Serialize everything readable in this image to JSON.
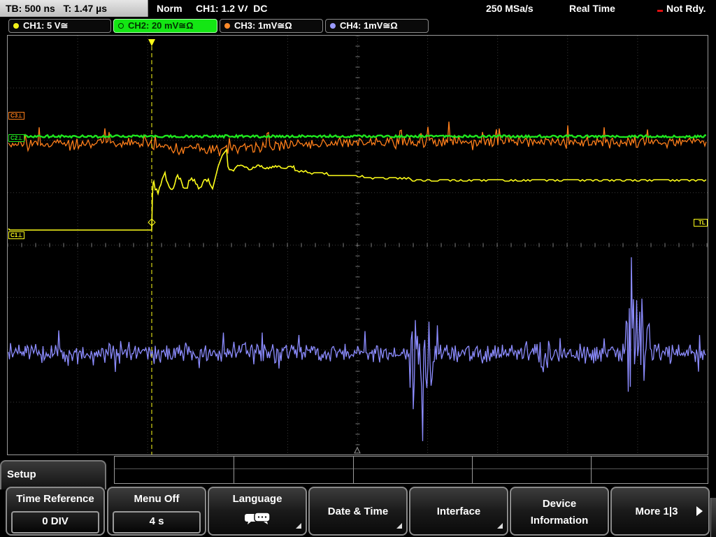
{
  "status_bar": {
    "timebase": "TB: 500 ns",
    "trigger_time": "T: 1.47 µs",
    "trigger_mode": "Norm",
    "trigger_source": "CH1: 1.2 V",
    "trigger_coupling": "DC",
    "sample_rate": "250 MSa/s",
    "acquire_mode": "Real Time",
    "status": "Not Rdy."
  },
  "channels": [
    {
      "label": "CH1: 5 V≅",
      "color": "#f2f21a",
      "active": false
    },
    {
      "label": "CH2: 20 mV≅Ω",
      "color": "#14e614",
      "active": true
    },
    {
      "label": "CH3: 1mV≅Ω",
      "color": "#ff8a2a",
      "active": false
    },
    {
      "label": "CH4: 1mV≅Ω",
      "color": "#9a9aff",
      "active": false
    }
  ],
  "markers": {
    "c3": "C3⊥",
    "c2": "C2⊥",
    "c1": "C1⊥",
    "tl": "TL",
    "t": "T"
  },
  "menu": {
    "title": "Setup",
    "softkeys": [
      {
        "label": "Time Reference",
        "value": "0 DIV",
        "icon": null
      },
      {
        "label": "Menu Off",
        "value": "4 s",
        "icon": null
      },
      {
        "label": "Language",
        "value": null,
        "icon": "speech-bubbles-icon"
      },
      {
        "label": "Date & Time",
        "value": null,
        "icon": null
      },
      {
        "label": "Interface",
        "value": null,
        "icon": null
      },
      {
        "label": "Device",
        "label2": "Information",
        "value": null,
        "icon": null
      },
      {
        "label": "More 1|3",
        "value": null,
        "icon": "arrow-right-icon"
      }
    ]
  }
}
